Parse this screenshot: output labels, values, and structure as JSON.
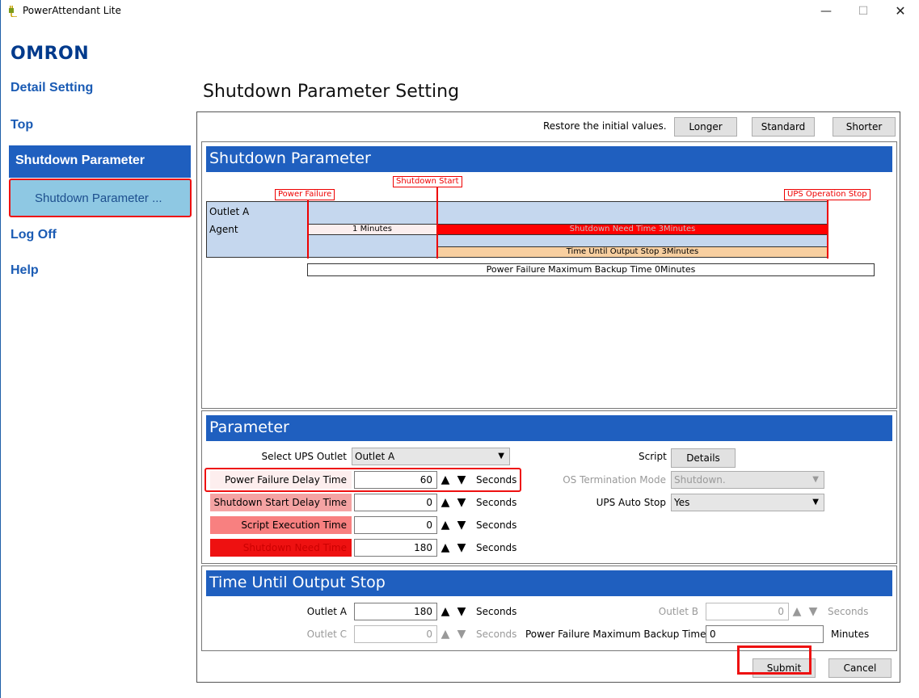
{
  "window": {
    "title": "PowerAttendant Lite",
    "minimize": "—",
    "maximize": "☐",
    "close": "✕"
  },
  "logo": "OMRON",
  "nav": {
    "detail_setting": "Detail Setting",
    "top": "Top",
    "shutdown_parameter": "Shutdown Parameter",
    "shutdown_parameter_sub": "Shutdown Parameter ...",
    "log_off": "Log Off",
    "help": "Help"
  },
  "page_title": "Shutdown Parameter Setting",
  "restore": {
    "label": "Restore the initial values.",
    "longer": "Longer",
    "standard": "Standard",
    "shorter": "Shorter"
  },
  "timeline": {
    "header": "Shutdown Parameter",
    "markers": {
      "power_failure": "Power Failure",
      "shutdown_start": "Shutdown Start",
      "ups_stop": "UPS Operation Stop"
    },
    "rows": {
      "outlet": "Outlet A",
      "agent": "Agent"
    },
    "bars": {
      "delay": "1 Minutes",
      "need_time": "Shutdown Need Time 3Minutes",
      "output_stop": "Time Until Output Stop 3Minutes",
      "backup": "Power Failure Maximum Backup Time 0Minutes"
    },
    "colors": {
      "need_time": "#ff0000",
      "output_stop": "#f8cfa0",
      "delay": "#fbeeee",
      "area": "#c5d7ee"
    }
  },
  "parameter": {
    "header": "Parameter",
    "select_outlet_label": "Select UPS Outlet",
    "select_outlet_value": "Outlet A",
    "power_failure_delay_label": "Power Failure Delay Time",
    "power_failure_delay_value": "60",
    "shutdown_start_delay_label": "Shutdown Start Delay Time",
    "shutdown_start_delay_value": "0",
    "script_exec_label": "Script Execution Time",
    "script_exec_value": "0",
    "shutdown_need_label": "Shutdown Need Time",
    "shutdown_need_value": "180",
    "unit_seconds": "Seconds",
    "script_label": "Script",
    "details_button": "Details",
    "os_term_label": "OS Termination Mode",
    "os_term_value": "Shutdown.",
    "ups_auto_stop_label": "UPS Auto Stop",
    "ups_auto_stop_value": "Yes",
    "label_colors": {
      "power_failure_delay": "#fdeeee",
      "shutdown_start_delay": "#f5a3a3",
      "script_exec": "#f88080",
      "shutdown_need": "#ee1111"
    }
  },
  "output_stop": {
    "header": "Time Until Output Stop",
    "outlet_a_label": "Outlet A",
    "outlet_a_value": "180",
    "outlet_b_label": "Outlet B",
    "outlet_b_value": "0",
    "outlet_c_label": "Outlet C",
    "outlet_c_value": "0",
    "backup_label": "Power Failure Maximum Backup Time",
    "backup_value": "0",
    "unit_seconds": "Seconds",
    "unit_minutes": "Minutes"
  },
  "footer": {
    "submit": "Submit",
    "cancel": "Cancel"
  }
}
